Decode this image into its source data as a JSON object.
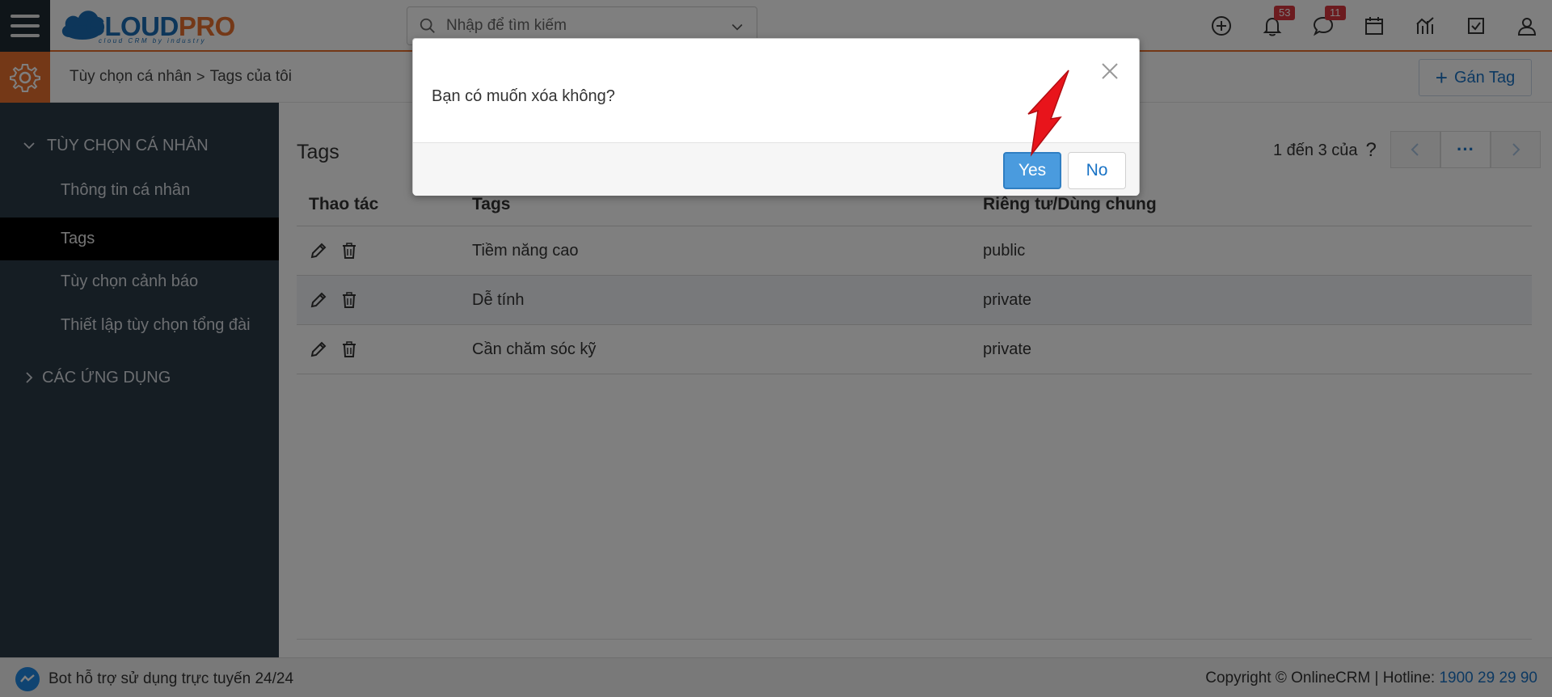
{
  "header": {
    "logo_text_a": "CLOUD",
    "logo_text_b": "PRO",
    "logo_sub": "cloud CRM by industry",
    "search_placeholder": "Nhập để tìm kiếm",
    "notifications_count": "53",
    "messages_count": "11",
    "icons": [
      "add-icon",
      "bell-icon",
      "chat-icon",
      "calendar-icon",
      "chart-icon",
      "checkbox-icon",
      "user-icon"
    ]
  },
  "subheader": {
    "breadcrumb_parent": "Tùy chọn cá nhân",
    "breadcrumb_sep": ">",
    "breadcrumb_current": "Tags của tôi",
    "assign_button": "Gán Tag"
  },
  "sidebar": {
    "section_personal": "TÙY CHỌN CÁ NHÂN",
    "items": [
      {
        "label": "Thông tin cá nhân"
      },
      {
        "label": "Tags",
        "active": true
      },
      {
        "label": "Tùy chọn cảnh báo"
      },
      {
        "label": "Thiết lập tùy chọn tổng đài"
      }
    ],
    "section_apps": "CÁC ỨNG DỤNG"
  },
  "main": {
    "title": "Tags",
    "pager_text": "1 đến 3 của",
    "pager_help": "?",
    "pager_more": "···",
    "table": {
      "headers": [
        "Thao tác",
        "Tags",
        "Riêng tư/Dùng chung"
      ],
      "rows": [
        {
          "tag": "Tiềm năng cao",
          "visibility": "public"
        },
        {
          "tag": "Dễ tính",
          "visibility": "private"
        },
        {
          "tag": "Cần chăm sóc kỹ",
          "visibility": "private"
        }
      ]
    }
  },
  "footer": {
    "bot_text": "Bot hỗ trợ sử dụng trực tuyến 24/24",
    "copyright": "Copyright © OnlineCRM | Hotline: ",
    "hotline": "1900 29 29 90"
  },
  "modal": {
    "message": "Bạn có muốn xóa không?",
    "yes_label": "Yes",
    "no_label": "No"
  },
  "colors": {
    "accent": "#e8712f",
    "brand_blue": "#1a73c5",
    "sidebar_bg": "#2b3a47",
    "yes_button": "#4a9bde",
    "arrow": "#e8141b"
  }
}
